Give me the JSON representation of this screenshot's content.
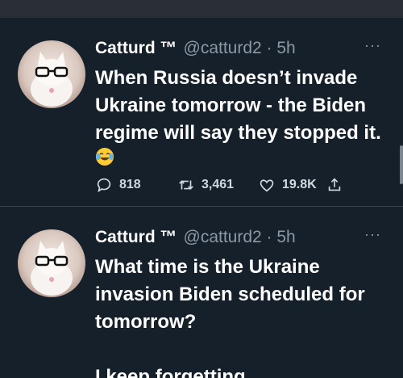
{
  "tweets": [
    {
      "author_name": "Catturd ™",
      "handle_time": "@catturd2 · 5h",
      "text": "When Russia doesn’t invade\nUkraine tomorrow - the Biden\nregime will say they stopped it.",
      "emoji": "face-with-tears-of-joy",
      "replies": "818",
      "retweets": "3,461",
      "likes": "19.8K"
    },
    {
      "author_name": "Catturd ™",
      "handle_time": "@catturd2 · 5h",
      "text": "What time is the Ukraine\ninvasion Biden scheduled for\ntomorrow?\n\nI keep forgetting."
    }
  ],
  "icons": {
    "more": "more-horizontal-icon",
    "reply": "reply-icon",
    "retweet": "retweet-icon",
    "like": "heart-icon",
    "share": "share-icon"
  },
  "colors": {
    "background": "#15202b",
    "secondary_text": "#8b98a5",
    "divider": "#38444d"
  }
}
